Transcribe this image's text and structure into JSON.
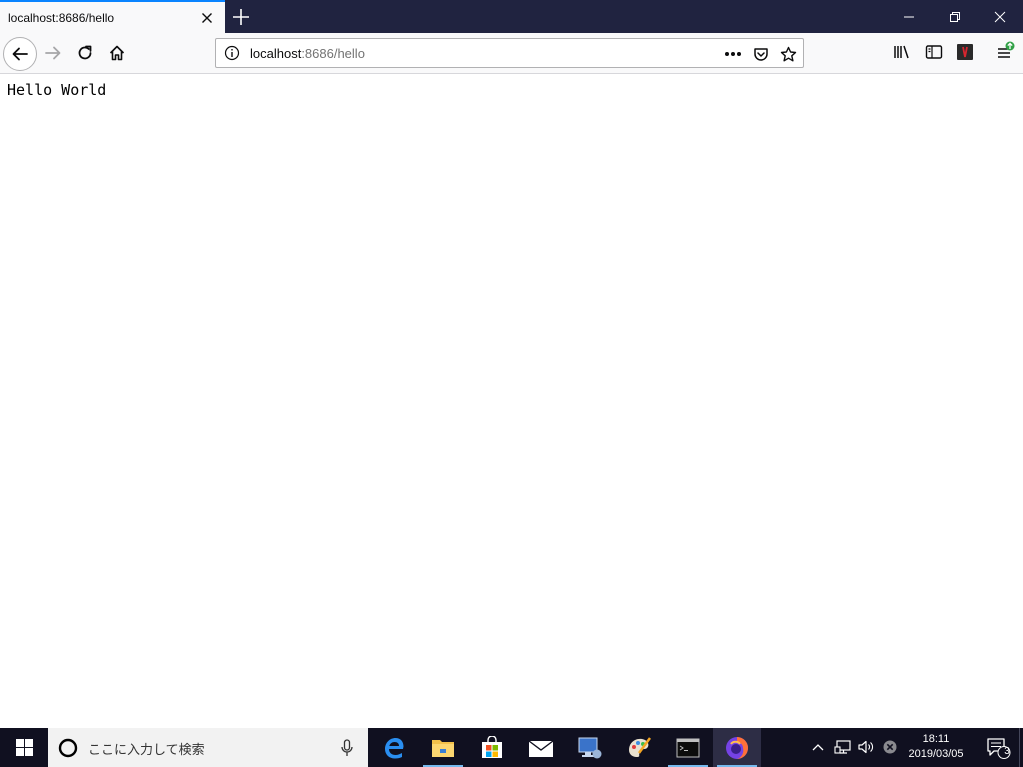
{
  "browser": {
    "tab": {
      "title": "localhost:8686/hello"
    },
    "urlbar": {
      "host": "localhost",
      "path": ":8686/hello"
    },
    "colors": {
      "titlebar": "#202340",
      "tab_accent": "#0a84ff",
      "toolbar": "#f9f9fa"
    },
    "toolbar_icons": [
      "back-icon",
      "forward-icon",
      "reload-icon",
      "home-icon",
      "page-actions-icon",
      "pocket-icon",
      "bookmark-star-icon",
      "library-icon",
      "sidebar-icon",
      "extension-icon",
      "menu-icon"
    ]
  },
  "page": {
    "body_text": "Hello World"
  },
  "taskbar": {
    "search_placeholder": "ここに入力して検索",
    "apps": [
      "edge-icon",
      "file-explorer-icon",
      "store-icon",
      "mail-icon",
      "remote-desktop-icon",
      "paint-icon",
      "terminal-icon",
      "firefox-icon"
    ],
    "clock": {
      "time": "18:11",
      "date": "2019/03/05"
    },
    "notification_count": "3"
  }
}
